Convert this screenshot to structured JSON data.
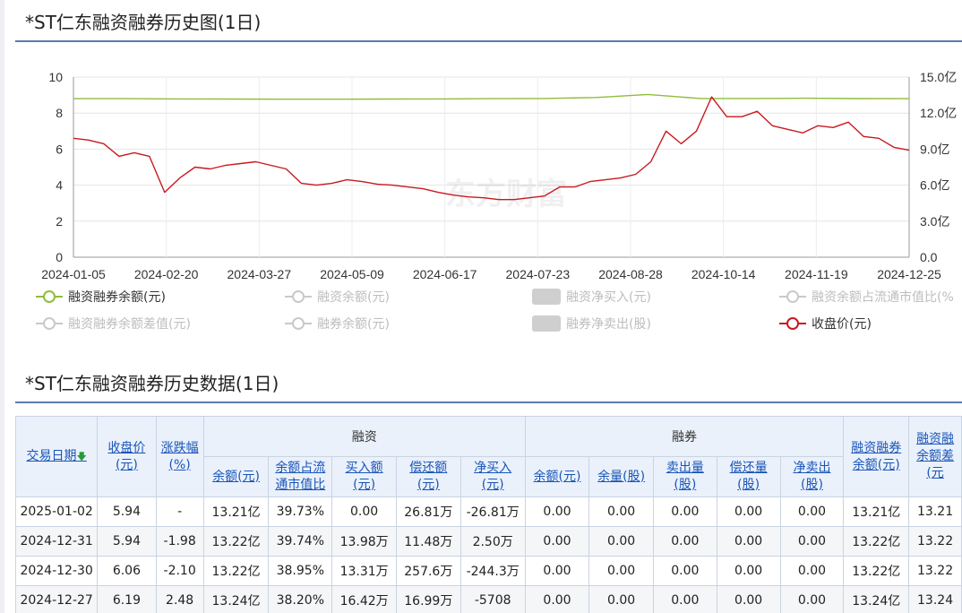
{
  "chart_section": {
    "title": "*ST仁东融资融券历史图(1日)"
  },
  "chart_data": {
    "type": "line",
    "left_axis": {
      "ticks": [
        "10",
        "8",
        "6",
        "4",
        "2",
        "0"
      ],
      "range": [
        0,
        10
      ]
    },
    "right_axis": {
      "ticks": [
        "15.0亿",
        "12.0亿",
        "9.0亿",
        "6.0亿",
        "3.0亿",
        "0.0"
      ],
      "range": [
        0,
        15
      ]
    },
    "x_ticks": [
      "2024-01-05",
      "2024-02-20",
      "2024-03-27",
      "2024-05-09",
      "2024-06-17",
      "2024-07-23",
      "2024-08-28",
      "2024-10-14",
      "2024-11-19",
      "2024-12-25"
    ],
    "grid": true,
    "series": [
      {
        "name": "融资融券余额(元)",
        "axis": "right",
        "color": "#8fbd3c",
        "values": [
          13.2,
          13.2,
          13.18,
          13.17,
          13.16,
          13.16,
          13.17,
          13.18,
          13.2,
          13.22,
          13.3,
          13.55,
          13.22,
          13.22,
          13.24,
          13.21,
          13.2
        ]
      },
      {
        "name": "收盘价(元)",
        "axis": "left",
        "color": "#c8191e",
        "values": [
          6.6,
          6.5,
          6.3,
          5.6,
          5.8,
          5.6,
          3.6,
          4.4,
          5.0,
          4.9,
          5.1,
          5.2,
          5.3,
          5.1,
          4.9,
          4.1,
          4.0,
          4.1,
          4.3,
          4.2,
          4.05,
          4.0,
          3.9,
          3.8,
          3.6,
          3.45,
          3.35,
          3.3,
          3.2,
          3.2,
          3.3,
          3.4,
          3.9,
          3.9,
          4.2,
          4.3,
          4.4,
          4.6,
          5.3,
          7.0,
          6.3,
          7.0,
          8.9,
          7.8,
          7.8,
          8.1,
          7.3,
          7.1,
          6.9,
          7.3,
          7.2,
          7.5,
          6.7,
          6.6,
          6.1,
          5.94
        ]
      }
    ]
  },
  "legend": [
    {
      "label": "融资融券余额(元)",
      "active": true,
      "color": "#8fbd3c",
      "shape": "line-circle"
    },
    {
      "label": "融资余额(元)",
      "active": false,
      "color": "#c9c9c9",
      "shape": "line-circle"
    },
    {
      "label": "融资净买入(元)",
      "active": false,
      "color": "#cfcfcf",
      "shape": "rect"
    },
    {
      "label": "融资余额占流通市值比(%",
      "active": false,
      "color": "#c9c9c9",
      "shape": "line-circle"
    },
    {
      "label": "融资融券余额差值(元)",
      "active": false,
      "color": "#c9c9c9",
      "shape": "line-circle"
    },
    {
      "label": "融券余额(元)",
      "active": false,
      "color": "#c9c9c9",
      "shape": "line-circle"
    },
    {
      "label": "融券净卖出(股)",
      "active": false,
      "color": "#cfcfcf",
      "shape": "rect"
    },
    {
      "label": "收盘价(元)",
      "active": true,
      "color": "#c8191e",
      "shape": "line-circle"
    }
  ],
  "watermark": "东方财富",
  "table_section": {
    "title": "*ST仁东融资融券历史数据(1日)"
  },
  "table": {
    "sort_icon": "sort-down-arrow-icon",
    "group_financing": "融资",
    "group_securities": "融券",
    "col_date": "交易日期",
    "col_close": [
      "收盘价",
      "(元)"
    ],
    "col_change": [
      "涨跌幅",
      "(%)"
    ],
    "fin_cols": [
      [
        "余额(元)"
      ],
      [
        "余额占流",
        "通市值比"
      ],
      [
        "买入额",
        "(元)"
      ],
      [
        "偿还额",
        "(元)"
      ],
      [
        "净买入",
        "(元)"
      ]
    ],
    "sec_cols": [
      [
        "余额(元)"
      ],
      [
        "余量(股)"
      ],
      [
        "卖出量",
        "(股)"
      ],
      [
        "偿还量",
        "(股)"
      ],
      [
        "净卖出",
        "(股)"
      ]
    ],
    "col_total": [
      "融资融券",
      "余额(元)"
    ],
    "col_diff": [
      "融资融",
      "余额差",
      "(元"
    ],
    "rows": [
      {
        "date": "2025-01-02",
        "close": "5.94",
        "change": "-",
        "fin": [
          "13.21亿",
          "39.73%",
          "0.00",
          "26.81万",
          "-26.81万"
        ],
        "sec": [
          "0.00",
          "0.00",
          "0.00",
          "0.00",
          "0.00"
        ],
        "total": "13.21亿",
        "diff": "13.21",
        "close_cls": "",
        "change_cls": "",
        "net_cls": "neg"
      },
      {
        "date": "2024-12-31",
        "close": "5.94",
        "change": "-1.98",
        "fin": [
          "13.22亿",
          "39.74%",
          "13.98万",
          "11.48万",
          "2.50万"
        ],
        "sec": [
          "0.00",
          "0.00",
          "0.00",
          "0.00",
          "0.00"
        ],
        "total": "13.22亿",
        "diff": "13.22",
        "close_cls": "neg",
        "change_cls": "neg",
        "net_cls": "pos"
      },
      {
        "date": "2024-12-30",
        "close": "6.06",
        "change": "-2.10",
        "fin": [
          "13.22亿",
          "38.95%",
          "13.31万",
          "257.6万",
          "-244.3万"
        ],
        "sec": [
          "0.00",
          "0.00",
          "0.00",
          "0.00",
          "0.00"
        ],
        "total": "13.22亿",
        "diff": "13.22",
        "close_cls": "neg",
        "change_cls": "neg",
        "net_cls": "neg"
      },
      {
        "date": "2024-12-27",
        "close": "6.19",
        "change": "2.48",
        "fin": [
          "13.24亿",
          "38.20%",
          "16.42万",
          "16.99万",
          "-5708"
        ],
        "sec": [
          "0.00",
          "0.00",
          "0.00",
          "0.00",
          "0.00"
        ],
        "total": "13.24亿",
        "diff": "13.24",
        "close_cls": "pos",
        "change_cls": "pos",
        "net_cls": "neg"
      }
    ]
  }
}
